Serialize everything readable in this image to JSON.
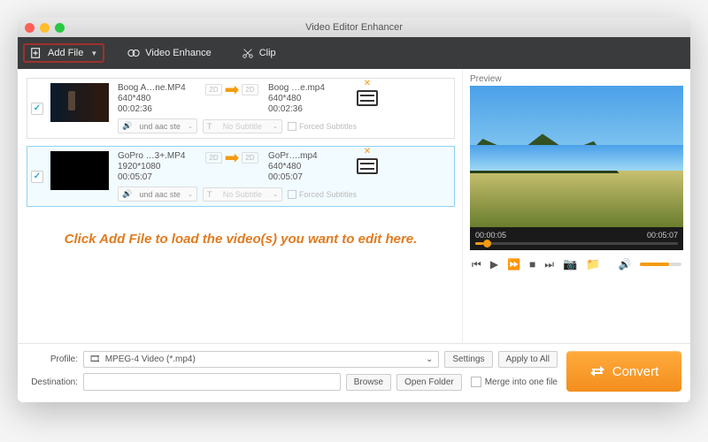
{
  "window": {
    "title": "Video Editor Enhancer"
  },
  "toolbar": {
    "add_file": "Add File",
    "video_enhance": "Video Enhance",
    "clip": "Clip"
  },
  "files": [
    {
      "checked": true,
      "name_in": "Boog A…ne.MP4",
      "res_in": "640*480",
      "dur_in": "00:02:36",
      "name_out": "Boog …e.mp4",
      "res_out": "640*480",
      "dur_out": "00:02:36",
      "audio": "und aac ste",
      "subtitle": "No Subtitle",
      "forced": "Forced Subtitles"
    },
    {
      "checked": true,
      "name_in": "GoPro …3+.MP4",
      "res_in": "1920*1080",
      "dur_in": "00:05:07",
      "name_out": "GoPr….mp4",
      "res_out": "640*480",
      "dur_out": "00:05:07",
      "audio": "und aac ste",
      "subtitle": "No Subtitle",
      "forced": "Forced Subtitles"
    }
  ],
  "placeholder": "Click Add File to load the video(s) you want to edit here.",
  "preview": {
    "label": "Preview",
    "time_current": "00:00:05",
    "time_total": "00:05:07"
  },
  "profile": {
    "label": "Profile:",
    "value": "MPEG-4 Video (*.mp4)",
    "settings": "Settings",
    "apply_all": "Apply to All"
  },
  "destination": {
    "label": "Destination:",
    "value": "",
    "browse": "Browse",
    "open_folder": "Open Folder",
    "merge": "Merge into one file"
  },
  "convert": "Convert",
  "dim_badges": {
    "in": "2D",
    "out": "2D"
  }
}
